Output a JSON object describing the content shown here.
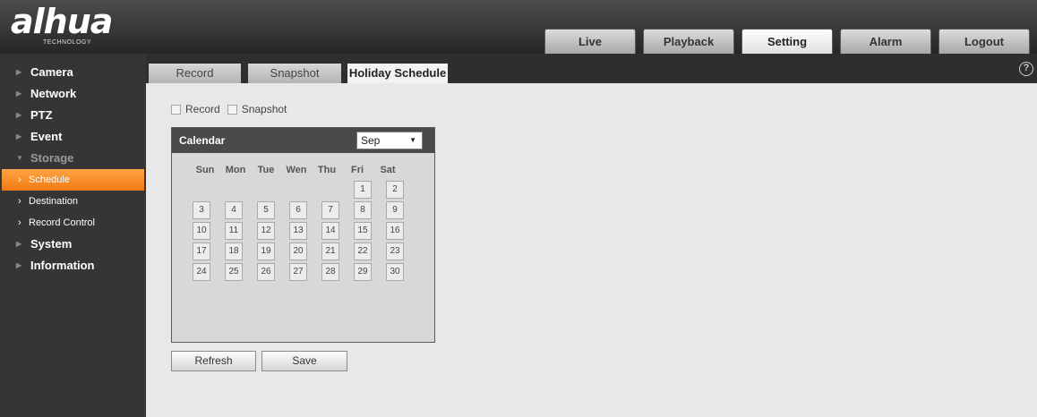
{
  "logo": {
    "text": "alhua",
    "tagline": "TECHNOLOGY"
  },
  "topnav": [
    {
      "label": "Live",
      "active": false
    },
    {
      "label": "Playback",
      "active": false
    },
    {
      "label": "Setting",
      "active": true
    },
    {
      "label": "Alarm",
      "active": false
    },
    {
      "label": "Logout",
      "active": false
    }
  ],
  "sidebar": {
    "items": [
      {
        "label": "Camera"
      },
      {
        "label": "Network"
      },
      {
        "label": "PTZ"
      },
      {
        "label": "Event"
      },
      {
        "label": "Storage"
      },
      {
        "label": "System"
      },
      {
        "label": "Information"
      }
    ],
    "storage_sub": [
      {
        "label": "Schedule"
      },
      {
        "label": "Destination"
      },
      {
        "label": "Record Control"
      }
    ]
  },
  "subtabs": [
    {
      "label": "Record"
    },
    {
      "label": "Snapshot"
    },
    {
      "label": "Holiday Schedule"
    }
  ],
  "help_icon": "?",
  "checks": {
    "record_label": "Record",
    "snapshot_label": "Snapshot"
  },
  "calendar": {
    "title": "Calendar",
    "month": "Sep",
    "weekdays": [
      "Sun",
      "Mon",
      "Tue",
      "Wen",
      "Thu",
      "Fri",
      "Sat"
    ],
    "days": [
      "1",
      "2",
      "3",
      "4",
      "5",
      "6",
      "7",
      "8",
      "9",
      "10",
      "11",
      "12",
      "13",
      "14",
      "15",
      "16",
      "17",
      "18",
      "19",
      "20",
      "21",
      "22",
      "23",
      "24",
      "25",
      "26",
      "27",
      "28",
      "29",
      "30"
    ]
  },
  "buttons": {
    "refresh_label": "Refresh",
    "save_label": "Save"
  }
}
